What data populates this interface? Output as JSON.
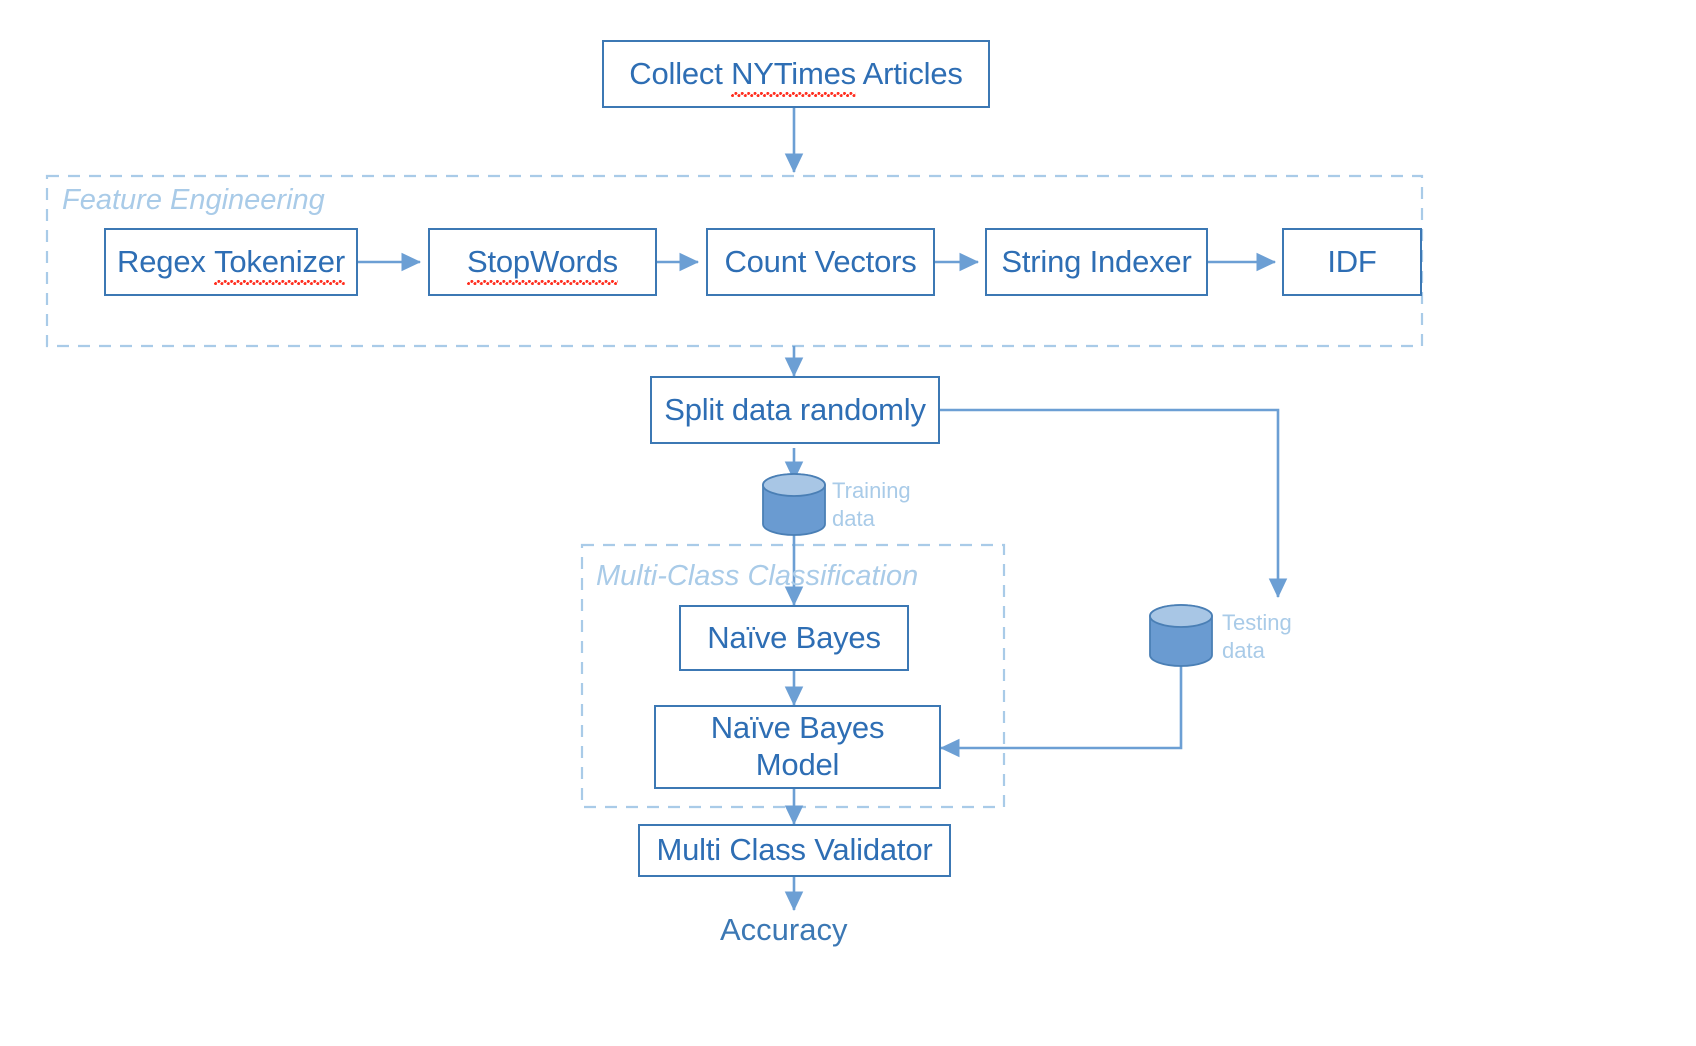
{
  "diagram": {
    "title": "NYTimes Articles Multi-Class Text Classification Pipeline",
    "colors": {
      "box_border": "#3c78b4",
      "box_text": "#2e6eb4",
      "arrow": "#6c9fd4",
      "group_dash": "#a9cbe8",
      "group_label_text": "#a9cbe8",
      "cylinder_body": "#6a9bd1",
      "cylinder_top": "#a8c6e5",
      "spellcheck_underline": "#ff2f20",
      "background": "#ffffff"
    }
  },
  "nodes": {
    "collect": {
      "label": "Collect NYTimes Articles",
      "misspelled": "NYTimes"
    },
    "regex_tokenizer": {
      "label": "Regex Tokenizer",
      "misspelled": "Tokenizer"
    },
    "stopwords": {
      "label": "StopWords",
      "misspelled": "StopWords"
    },
    "count_vectors": {
      "label": "Count Vectors"
    },
    "string_indexer": {
      "label": "String Indexer"
    },
    "idf": {
      "label": "IDF"
    },
    "split_data": {
      "label": "Split data randomly"
    },
    "naive_bayes": {
      "label": "Naïve Bayes"
    },
    "naive_bayes_model": {
      "label": "Naïve Bayes\nModel"
    },
    "multi_class_validator": {
      "label": "Multi Class Validator"
    },
    "accuracy": {
      "label": "Accuracy"
    }
  },
  "groups": {
    "feature_engineering": {
      "label": "Feature Engineering"
    },
    "multi_class_classification": {
      "label": "Multi-Class Classification"
    }
  },
  "datastores": {
    "training": {
      "label": "Training\ndata"
    },
    "testing": {
      "label": "Testing\ndata"
    }
  }
}
